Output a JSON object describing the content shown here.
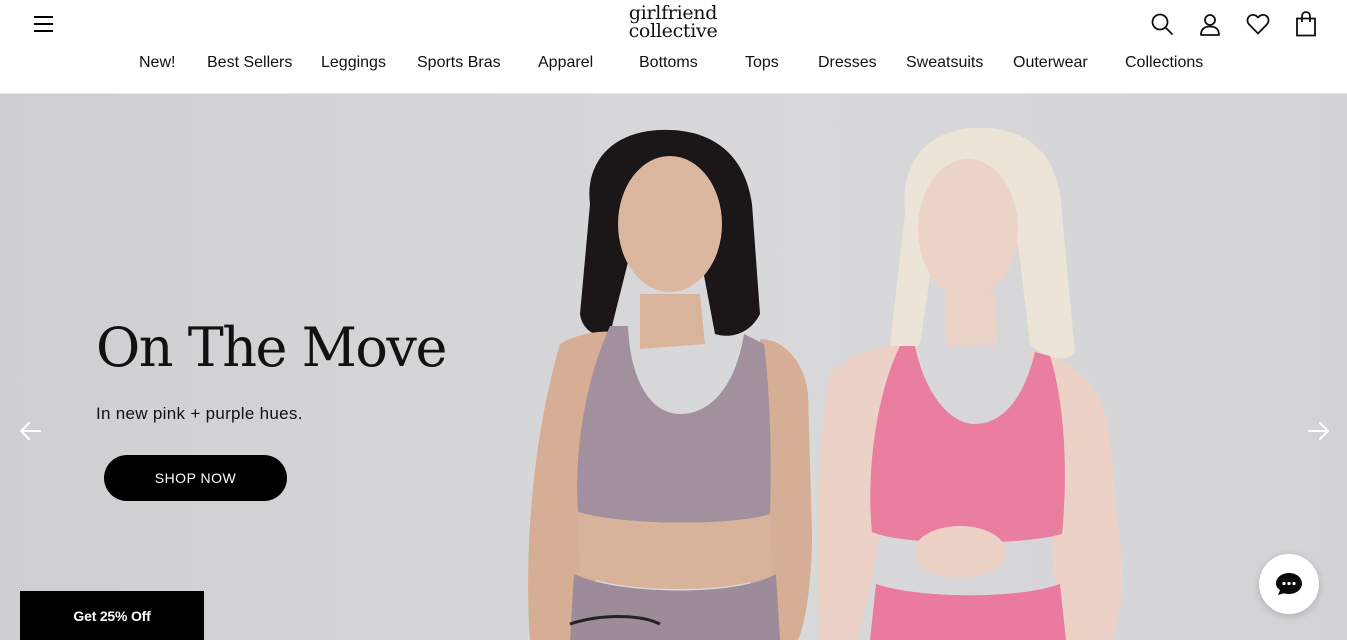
{
  "header": {
    "logo_line1": "girlfriend",
    "logo_line2": "collective",
    "icons": [
      "menu-icon",
      "search-icon",
      "account-icon",
      "heart-icon",
      "bag-icon"
    ]
  },
  "nav": {
    "items": [
      "New!",
      "Best Sellers",
      "Leggings",
      "Sports Bras",
      "Apparel",
      "Bottoms",
      "Tops",
      "Dresses",
      "Sweatsuits",
      "Outerwear",
      "Collections"
    ]
  },
  "hero": {
    "heading": "On The Move",
    "subheading": "In new pink + purple hues.",
    "cta_label": "SHOP NOW",
    "colors": {
      "background": "#d5d5d7",
      "purple_top": "#a18f9f",
      "pink_top": "#ea7e9f",
      "button": "#000000"
    }
  },
  "promo": {
    "label": "Get 25% Off"
  },
  "chat": {
    "icon": "chat-bubble-icon"
  }
}
